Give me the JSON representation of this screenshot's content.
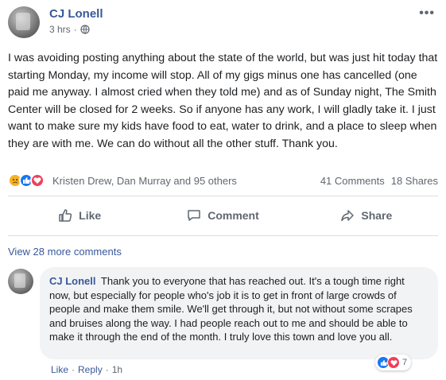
{
  "post": {
    "author": "CJ Lonell",
    "time": "3 hrs",
    "privacy_icon": "globe-icon",
    "more_icon": "ellipsis-icon",
    "text": "I was avoiding posting anything about the state of the world, but was just hit today that starting Monday, my income will stop. All of my gigs minus one has cancelled (one paid me anyway. I almost cried when they told me) and as of Sunday night, The Smith Center will be closed for 2 weeks. So if anyone has any work, I will gladly take it. I just want to make sure my kids have food to eat, water to drink, and a place to sleep when they are with me. We can do without all the other stuff. Thank you."
  },
  "reactions": {
    "icons": [
      "sad-icon",
      "like-icon",
      "love-icon"
    ],
    "reactors": "Kristen Drew, Dan Murray and 95 others",
    "comments": "41 Comments",
    "shares": "18 Shares"
  },
  "actions": {
    "like": "Like",
    "comment": "Comment",
    "share": "Share"
  },
  "comments_section": {
    "view_more": "View 28 more comments",
    "comment": {
      "author": "CJ Lonell",
      "text": "Thank you to everyone that has reached out. It's a tough time right now, but especially for people who's job it is to get in front of large crowds of people and make them smile. We'll get through it, but not without some scrapes and bruises along the way. I had people reach out to me and should be able to make it through the end of the month. I truly love this town and love you all.",
      "like": "Like",
      "reply": "Reply",
      "separator": "·",
      "time": "1h",
      "reaction_count": "7"
    }
  },
  "colors": {
    "link": "#385898",
    "like_blue": "#1877f2",
    "love_red": "#f33e58",
    "sad_yellow": "#f7b125",
    "secondary_text": "#606770"
  }
}
